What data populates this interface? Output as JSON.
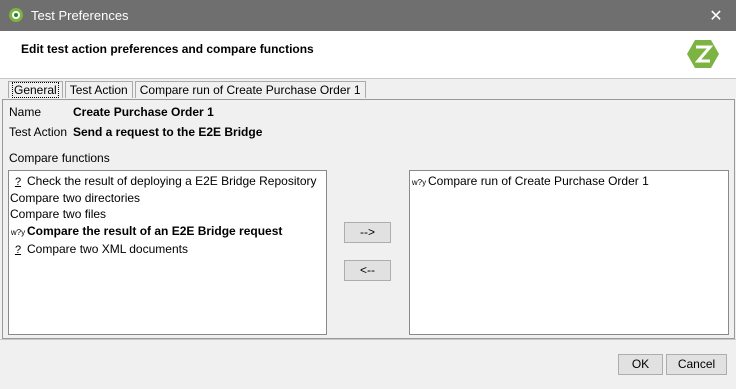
{
  "window": {
    "title": "Test Preferences",
    "close_glyph": "✕"
  },
  "header": {
    "heading": "Edit test action preferences and compare functions"
  },
  "tabs": [
    {
      "label": "General"
    },
    {
      "label": "Test Action"
    },
    {
      "label": "Compare run of Create Purchase Order 1"
    }
  ],
  "general": {
    "name_label": "Name",
    "name_value": "Create Purchase Order 1",
    "action_label": "Test Action",
    "action_value": "Send a request to the E2E Bridge",
    "compare_label": "Compare functions"
  },
  "available_functions": [
    {
      "icon": "?",
      "label": "Check the result of deploying a E2E Bridge Repository"
    },
    {
      "icon": "",
      "label": "Compare two directories"
    },
    {
      "icon": "",
      "label": "Compare two files"
    },
    {
      "icon": "w?y",
      "label": "Compare the result of an E2E Bridge request"
    },
    {
      "icon": "?",
      "label": "Compare two XML documents"
    }
  ],
  "selected_functions": [
    {
      "icon": "w?y",
      "label": "Compare run of Create Purchase Order 1"
    }
  ],
  "buttons": {
    "add": "-->",
    "remove": "<--",
    "ok": "OK",
    "cancel": "Cancel"
  },
  "colors": {
    "titlebar": "#6f6f6f",
    "accent": "#7cb342"
  }
}
